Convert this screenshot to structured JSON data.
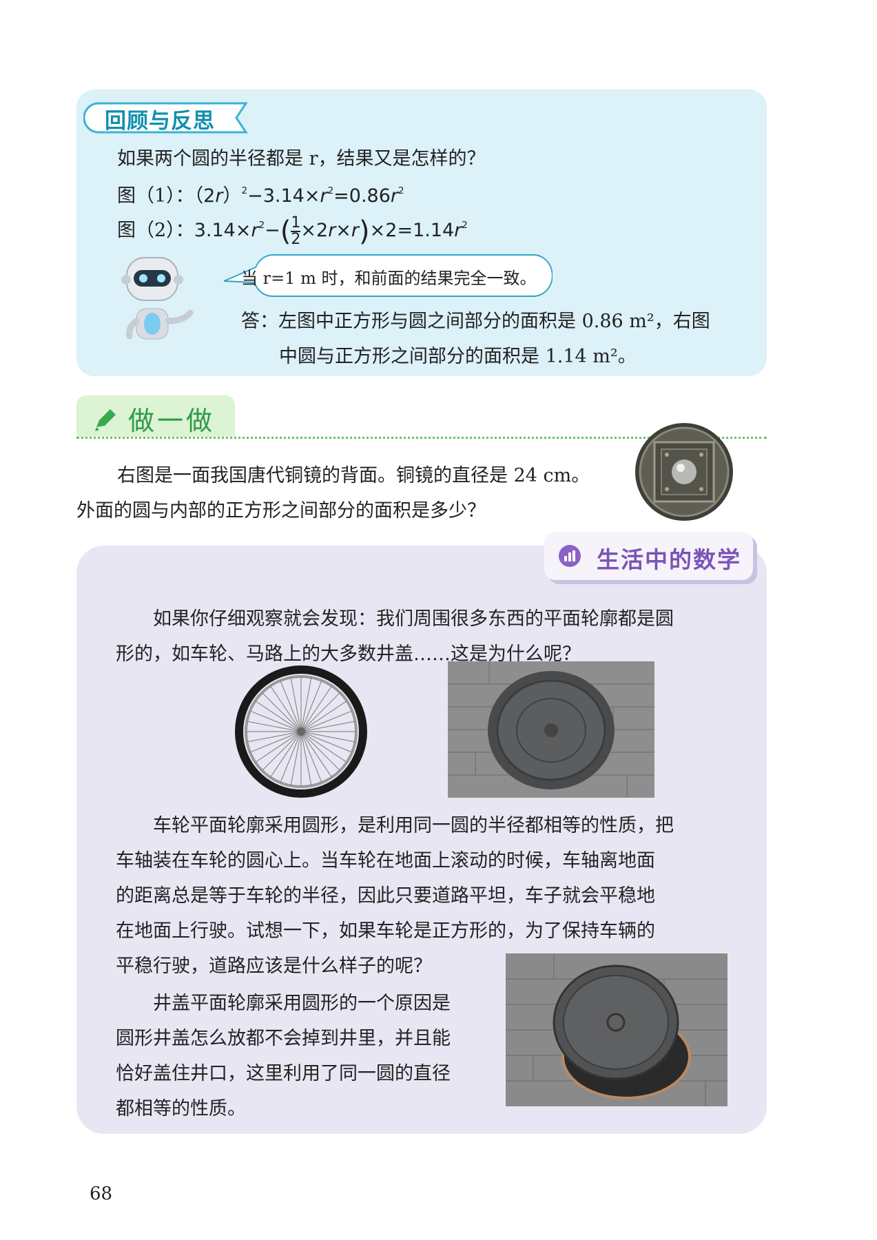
{
  "review": {
    "title": "回顾与反思",
    "question": "如果两个圆的半径都是 r，结果又是怎样的？",
    "formula1_label": "图（1）：",
    "formula2_label": "图（2）：",
    "bubble": "当 r=1 m 时，和前面的结果完全一致。",
    "answer_line1": "答：左图中正方形与圆之间部分的面积是 0.86 m²，右图",
    "answer_line2": "中圆与正方形之间部分的面积是 1.14 m²。"
  },
  "doit": {
    "title": "做一做",
    "line1": "右图是一面我国唐代铜镜的背面。铜镜的直径是 24 cm。",
    "line2": "外面的圆与内部的正方形之间部分的面积是多少？"
  },
  "life": {
    "title": "生活中的数学",
    "p1_line1": "如果你仔细观察就会发现：我们周围很多东西的平面轮廓都是圆",
    "p1_line2": "形的，如车轮、马路上的大多数井盖……这是为什么呢？",
    "p2_line1": "车轮平面轮廓采用圆形，是利用同一圆的半径都相等的性质，把",
    "p2_line2": "车轴装在车轮的圆心上。当车轮在地面上滚动的时候，车轴离地面",
    "p2_line3": "的距离总是等于车轮的半径，因此只要道路平坦，车子就会平稳地",
    "p2_line4": "在地面上行驶。试想一下，如果车轮是正方形的，为了保持车辆的",
    "p2_line5": "平稳行驶，道路应该是什么样子的呢？",
    "p3_line1": "井盖平面轮廓采用圆形的一个原因是",
    "p3_line2": "圆形井盖怎么放都不会掉到井里，并且能",
    "p3_line3": "恰好盖住井口，这里利用了同一圆的直径",
    "p3_line4": "都相等的性质。"
  },
  "page_number": "68"
}
